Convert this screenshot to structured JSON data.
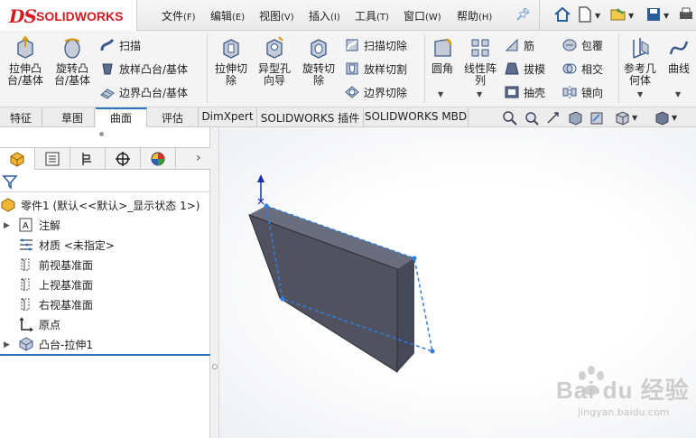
{
  "app": {
    "logo_mark": "DS",
    "logo_text": "SOLIDWORKS"
  },
  "menu": [
    {
      "label": "文件",
      "accel": "(F)"
    },
    {
      "label": "编辑",
      "accel": "(E)"
    },
    {
      "label": "视图",
      "accel": "(V)"
    },
    {
      "label": "插入",
      "accel": "(I)"
    },
    {
      "label": "工具",
      "accel": "(T)"
    },
    {
      "label": "窗口",
      "accel": "(W)"
    },
    {
      "label": "帮助",
      "accel": "(H)"
    }
  ],
  "ribbon": {
    "extrude_boss": "拉伸凸台/基体",
    "revolve_boss": "旋转凸台/基体",
    "sweep": "扫描",
    "loft_boss": "放样凸台/基体",
    "boundary_boss": "边界凸台/基体",
    "extrude_cut": "拉伸切除",
    "hole_wizard": "异型孔向导",
    "revolve_cut": "旋转切除",
    "swept_cut": "扫描切除",
    "lofted_cut": "放样切割",
    "boundary_cut": "边界切除",
    "fillet": "圆角",
    "linear_pattern": "线性阵列",
    "rib": "筋",
    "draft": "拔模",
    "shell": "抽壳",
    "wrap": "包覆",
    "intersect": "相交",
    "mirror": "镜向",
    "ref_geometry": "参考几何体",
    "curves": "曲线"
  },
  "tabs": [
    "特征",
    "草图",
    "曲面",
    "评估",
    "DimXpert",
    "SOLIDWORKS 插件",
    "SOLIDWORKS MBD"
  ],
  "active_tab": "曲面",
  "tree": {
    "part": "零件1 (默认<<默认>_显示状态 1>)",
    "annotations": "注解",
    "material": "材质 <未指定>",
    "front_plane": "前视基准面",
    "top_plane": "上视基准面",
    "right_plane": "右视基准面",
    "origin": "原点",
    "boss_extrude": "凸台-拉伸1"
  },
  "watermark": {
    "text": "Bai du 经验",
    "url": "jingyan.baidu.com"
  },
  "colors": {
    "accent": "#2a73c8",
    "brand": "#d71920",
    "body": "#55596a",
    "selection": "#2f7fe0"
  }
}
